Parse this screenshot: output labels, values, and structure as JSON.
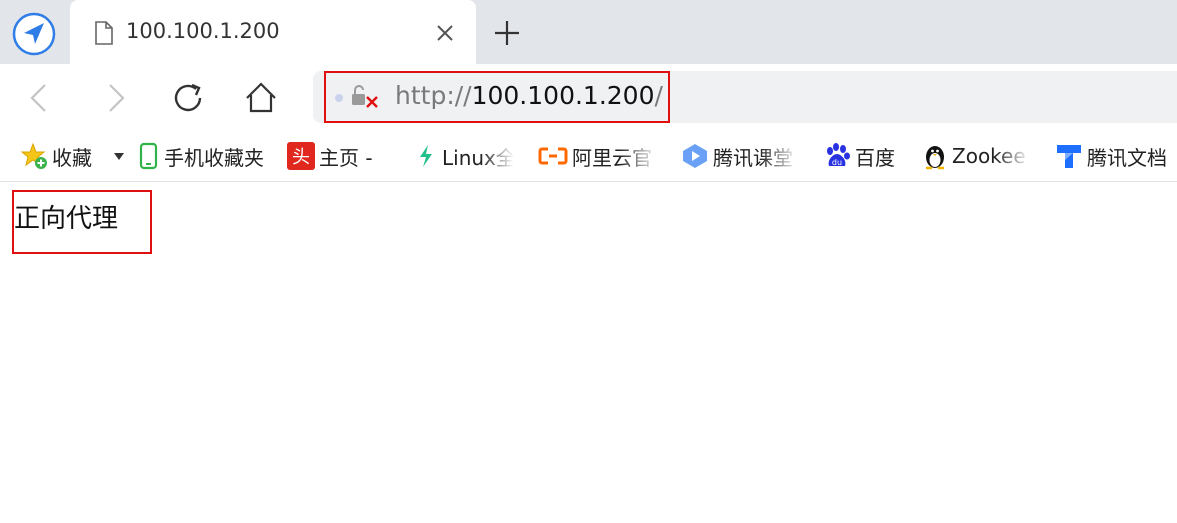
{
  "tab": {
    "title": "100.100.1.200"
  },
  "address_bar": {
    "protocol": "http://",
    "host": "100.100.1.200",
    "path": "/"
  },
  "bookmarks": [
    {
      "label": "收藏",
      "icon": "favorites-star-icon"
    },
    {
      "label": "手机收藏夹",
      "icon": "phone-icon"
    },
    {
      "label": "主页 -",
      "icon": "toutiao-icon"
    },
    {
      "label": "Linux全",
      "icon": "linux-leaf-icon"
    },
    {
      "label": "阿里云官",
      "icon": "aliyun-icon"
    },
    {
      "label": "腾讯课堂",
      "icon": "tencent-classroom-icon"
    },
    {
      "label": "百度",
      "icon": "baidu-paw-icon"
    },
    {
      "label": "Zookee",
      "icon": "penguin-icon"
    },
    {
      "label": "腾讯文档",
      "icon": "tencent-docs-icon"
    }
  ],
  "page": {
    "text": "正向代理"
  },
  "colors": {
    "highlight": "#e01010",
    "tab_bar": "#e2e5ea",
    "address_bg": "#eff1f3",
    "accent": "#2f7de6"
  }
}
